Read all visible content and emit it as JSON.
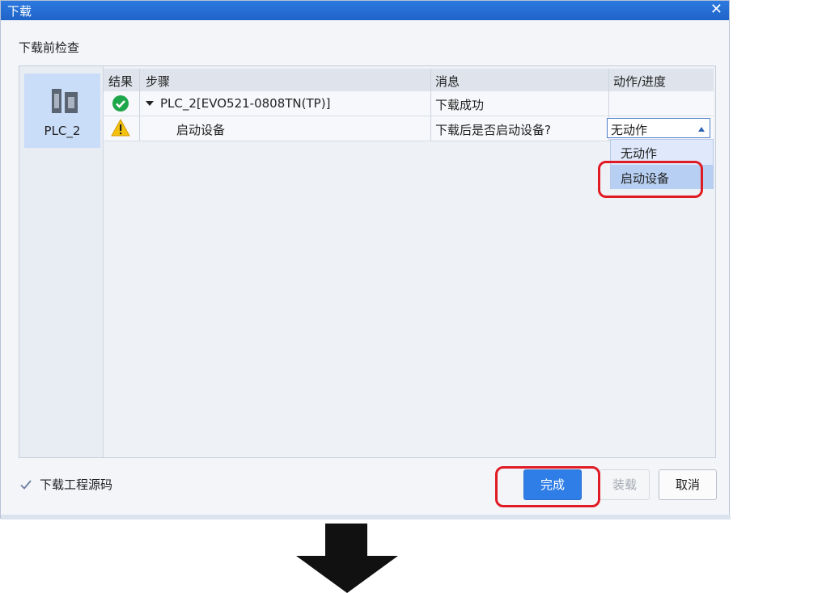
{
  "window": {
    "title": "下载",
    "close": "✕"
  },
  "section_label": "下载前检查",
  "device": {
    "name": "PLC_2"
  },
  "table": {
    "headers": [
      "结果",
      "步骤",
      "消息",
      "动作/进度"
    ],
    "rows": [
      {
        "result_icon": "check-circle-icon",
        "step": "PLC_2[EVO521-0808TN(TP)]",
        "message": "下载成功",
        "action": ""
      },
      {
        "result_icon": "warning-icon",
        "step": "启动设备",
        "message": "下载后是否启动设备?",
        "action": "无动作"
      }
    ]
  },
  "dropdown": {
    "options": [
      "无动作",
      "启动设备"
    ],
    "highlighted": "启动设备"
  },
  "footer": {
    "checkbox_label": "下载工程源码",
    "checkbox_checked": true,
    "buttons": {
      "finish": "完成",
      "load": "装载",
      "cancel": "取消"
    }
  },
  "colors": {
    "titlebar": "#1f63c7",
    "primary": "#2f7ee8",
    "highlight_box": "#e01b24"
  }
}
